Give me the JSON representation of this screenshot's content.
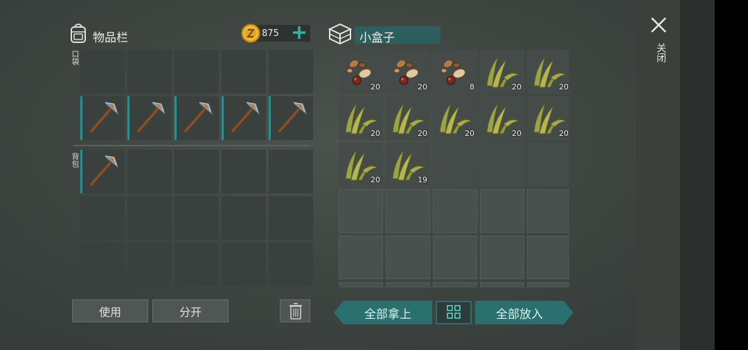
{
  "inventory": {
    "title": "物品栏",
    "coins": "875",
    "pocket_label": "口袋",
    "backpack_label": "背包",
    "pocket_slots": [
      {
        "item": "",
        "count": ""
      },
      {
        "item": "",
        "count": ""
      },
      {
        "item": "",
        "count": ""
      },
      {
        "item": "",
        "count": ""
      },
      {
        "item": "",
        "count": ""
      },
      {
        "item": "pickaxe",
        "count": ""
      },
      {
        "item": "pickaxe",
        "count": ""
      },
      {
        "item": "pickaxe",
        "count": ""
      },
      {
        "item": "pickaxe",
        "count": ""
      },
      {
        "item": "pickaxe",
        "count": ""
      }
    ],
    "backpack_slots": [
      {
        "item": "pickaxe",
        "count": ""
      },
      {
        "item": "",
        "count": ""
      },
      {
        "item": "",
        "count": ""
      },
      {
        "item": "",
        "count": ""
      },
      {
        "item": "",
        "count": ""
      },
      {
        "item": "",
        "count": ""
      },
      {
        "item": "",
        "count": ""
      },
      {
        "item": "",
        "count": ""
      },
      {
        "item": "",
        "count": ""
      },
      {
        "item": "",
        "count": ""
      },
      {
        "item": "",
        "count": ""
      },
      {
        "item": "",
        "count": ""
      },
      {
        "item": "",
        "count": ""
      },
      {
        "item": "",
        "count": ""
      },
      {
        "item": "",
        "count": ""
      }
    ]
  },
  "buttons": {
    "use": "使用",
    "split": "分开",
    "take_all": "全部拿上",
    "put_all": "全部放入",
    "close": "关闭"
  },
  "box": {
    "title": "小盒子",
    "slots": [
      {
        "item": "seeds",
        "count": "20"
      },
      {
        "item": "seeds",
        "count": "20"
      },
      {
        "item": "seeds",
        "count": "8"
      },
      {
        "item": "plant-fiber",
        "count": "20"
      },
      {
        "item": "plant-fiber",
        "count": "20"
      },
      {
        "item": "plant-fiber",
        "count": "20"
      },
      {
        "item": "plant-fiber",
        "count": "20"
      },
      {
        "item": "plant-fiber",
        "count": "20"
      },
      {
        "item": "plant-fiber",
        "count": "20"
      },
      {
        "item": "plant-fiber",
        "count": "20"
      },
      {
        "item": "plant-fiber",
        "count": "20"
      },
      {
        "item": "plant-fiber",
        "count": "19"
      },
      {
        "item": "",
        "count": ""
      },
      {
        "item": "",
        "count": ""
      },
      {
        "item": "",
        "count": ""
      },
      {
        "item": "",
        "count": ""
      },
      {
        "item": "",
        "count": ""
      },
      {
        "item": "",
        "count": ""
      },
      {
        "item": "",
        "count": ""
      },
      {
        "item": "",
        "count": ""
      },
      {
        "item": "",
        "count": ""
      },
      {
        "item": "",
        "count": ""
      },
      {
        "item": "",
        "count": ""
      },
      {
        "item": "",
        "count": ""
      },
      {
        "item": "",
        "count": ""
      },
      {
        "item": "",
        "count": ""
      },
      {
        "item": "",
        "count": ""
      },
      {
        "item": "",
        "count": ""
      },
      {
        "item": "",
        "count": ""
      },
      {
        "item": "",
        "count": ""
      }
    ]
  },
  "colors": {
    "accent_teal": "#2a706e",
    "coin_gold": "#e0a820",
    "plus_green": "#2fb3a6"
  }
}
